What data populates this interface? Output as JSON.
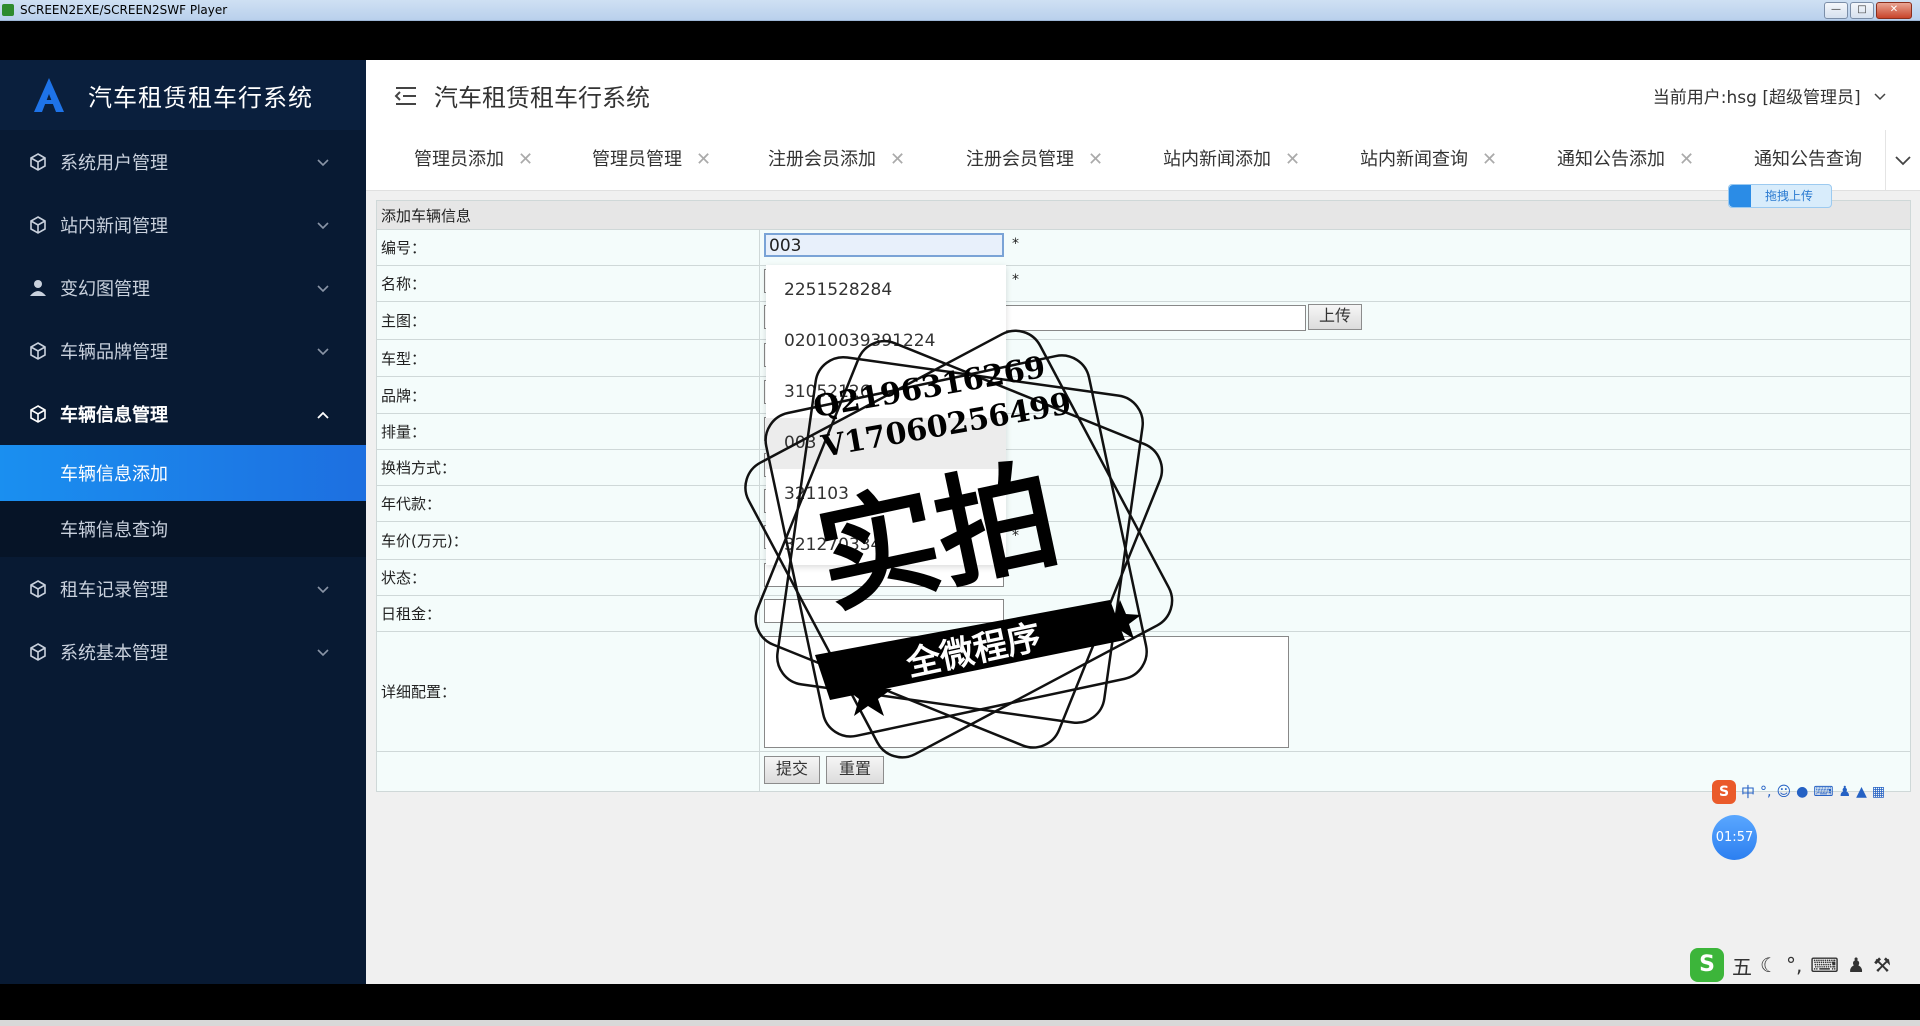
{
  "player": {
    "title": "SCREEN2EXE/SCREEN2SWF Player"
  },
  "brand": {
    "title": "汽车租赁租车行系统"
  },
  "header": {
    "title": "汽车租赁租车行系统",
    "current_user": "当前用户:hsg [超级管理员]"
  },
  "sidebar": {
    "items": [
      {
        "label": "系统用户管理",
        "icon": "cube-icon"
      },
      {
        "label": "站内新闻管理",
        "icon": "cube-icon"
      },
      {
        "label": "变幻图管理",
        "icon": "user-icon"
      },
      {
        "label": "车辆品牌管理",
        "icon": "cube-icon"
      },
      {
        "label": "车辆信息管理",
        "icon": "cube-icon"
      }
    ],
    "subitems": [
      {
        "label": "车辆信息添加"
      },
      {
        "label": "车辆信息查询"
      }
    ],
    "items_after": [
      {
        "label": "租车记录管理",
        "icon": "cube-icon"
      },
      {
        "label": "系统基本管理",
        "icon": "cube-icon"
      }
    ]
  },
  "tabs": [
    {
      "label": "管理员添加"
    },
    {
      "label": "管理员管理"
    },
    {
      "label": "注册会员添加"
    },
    {
      "label": "注册会员管理"
    },
    {
      "label": "站内新闻添加"
    },
    {
      "label": "站内新闻查询"
    },
    {
      "label": "通知公告添加"
    },
    {
      "label": "通知公告查询"
    }
  ],
  "form": {
    "caption": "添加车辆信息",
    "fields": {
      "code": {
        "label": "编号：",
        "value": "003"
      },
      "name": {
        "label": "名称："
      },
      "image": {
        "label": "主图："
      },
      "model": {
        "label": "车型："
      },
      "brand": {
        "label": "品牌："
      },
      "displacement": {
        "label": "排量："
      },
      "gearbox": {
        "label": "换档方式："
      },
      "year": {
        "label": "年代款："
      },
      "price": {
        "label": "车价(万元)："
      },
      "status": {
        "label": "状态："
      },
      "daily_rent": {
        "label": "日租金："
      },
      "config": {
        "label": "详细配置："
      }
    },
    "required_mark": "*",
    "upload_label": "上传",
    "submit_label": "提交",
    "reset_label": "重置"
  },
  "autocomplete": {
    "options": [
      "2251528284",
      "02010039391224",
      "31052126",
      "003",
      "321103",
      "321270334"
    ]
  },
  "watermark": {
    "line1": "Q2196316269",
    "line2": "V17060256499",
    "big": "实拍",
    "banner": "全微程序"
  },
  "widgets": {
    "upload_pill": "拖拽上传",
    "ime_mode": "中",
    "timer": "01:57",
    "ime2_label": "五"
  },
  "colors": {
    "sidebar_bg": "#081a33",
    "active_item": "#1a8ff0",
    "form_bg": "#f4fcfb"
  }
}
